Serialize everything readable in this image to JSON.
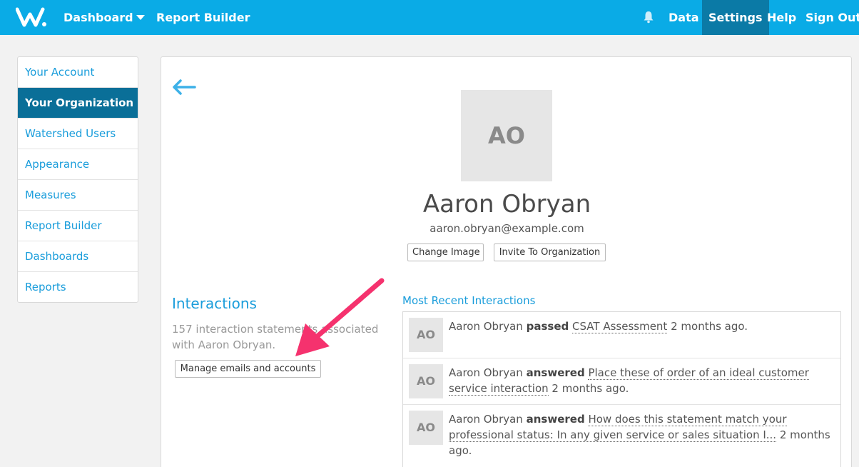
{
  "nav": {
    "logo_icon": "watershed-logo-icon",
    "dashboard": "Dashboard",
    "report_builder": "Report Builder",
    "data": "Data",
    "settings": "Settings",
    "help": "Help",
    "sign_out": "Sign Out",
    "bg_color": "#0aabe6",
    "active_color": "#0b7aa6"
  },
  "sidebar": {
    "items": [
      {
        "label": "Your Account"
      },
      {
        "label": "Your Organization",
        "active": true
      },
      {
        "label": "Watershed Users"
      },
      {
        "label": "Appearance"
      },
      {
        "label": "Measures"
      },
      {
        "label": "Report Builder"
      },
      {
        "label": "Dashboards"
      },
      {
        "label": "Reports"
      }
    ]
  },
  "profile": {
    "initials": "AO",
    "name": "Aaron Obryan",
    "email": "aaron.obryan@example.com",
    "change_image": "Change Image",
    "invite": "Invite To Organization"
  },
  "interactions": {
    "title": "Interactions",
    "description": "157 interaction statements associated with Aaron Obryan.",
    "manage_button": "Manage emails and accounts"
  },
  "recent": {
    "title": "Most Recent Interactions",
    "items": [
      {
        "initials": "AO",
        "actor": "Aaron Obryan",
        "verb": "passed",
        "object": "CSAT Assessment",
        "time": "2 months ago."
      },
      {
        "initials": "AO",
        "actor": "Aaron Obryan",
        "verb": "answered",
        "object": "Place these of order of an ideal customer service interaction",
        "time": "2 months ago."
      },
      {
        "initials": "AO",
        "actor": "Aaron Obryan",
        "verb": "answered",
        "object": "How does this statement match your professional status: In any given service or sales situation I...",
        "time": "2 months ago."
      }
    ]
  },
  "annotation": {
    "color": "#f5326e",
    "icon": "pointer-arrow-icon"
  }
}
